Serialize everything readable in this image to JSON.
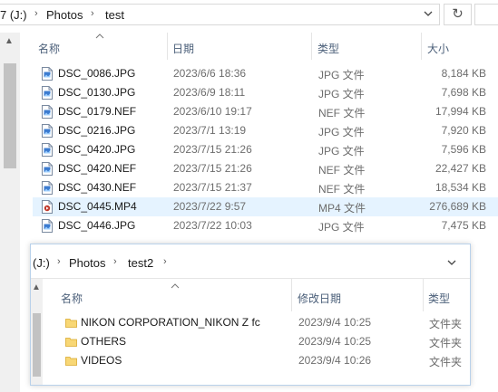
{
  "win1": {
    "address": {
      "crumbs": [
        "7 (J:)",
        "Photos",
        "test"
      ],
      "separator": "›",
      "dropdown_icon": "chevron-down-icon",
      "refresh_icon": "refresh-icon",
      "refresh_glyph": "↻"
    },
    "columns": {
      "name": "名称",
      "date": "日期",
      "type": "类型",
      "size": "大小"
    },
    "files": [
      {
        "name": "DSC_0086.JPG",
        "date": "2023/6/6 18:36",
        "type": "JPG 文件",
        "size": "8,184 KB",
        "icon": "image-file-icon"
      },
      {
        "name": "DSC_0130.JPG",
        "date": "2023/6/9 18:11",
        "type": "JPG 文件",
        "size": "7,698 KB",
        "icon": "image-file-icon"
      },
      {
        "name": "DSC_0179.NEF",
        "date": "2023/6/10 19:17",
        "type": "NEF 文件",
        "size": "17,994 KB",
        "icon": "image-file-icon"
      },
      {
        "name": "DSC_0216.JPG",
        "date": "2023/7/1 13:19",
        "type": "JPG 文件",
        "size": "7,920 KB",
        "icon": "image-file-icon"
      },
      {
        "name": "DSC_0420.JPG",
        "date": "2023/7/15 21:26",
        "type": "JPG 文件",
        "size": "7,596 KB",
        "icon": "image-file-icon"
      },
      {
        "name": "DSC_0420.NEF",
        "date": "2023/7/15 21:26",
        "type": "NEF 文件",
        "size": "22,427 KB",
        "icon": "image-file-icon"
      },
      {
        "name": "DSC_0430.NEF",
        "date": "2023/7/15 21:37",
        "type": "NEF 文件",
        "size": "18,534 KB",
        "icon": "image-file-icon"
      },
      {
        "name": "DSC_0445.MP4",
        "date": "2023/7/22 9:57",
        "type": "MP4 文件",
        "size": "276,689 KB",
        "icon": "video-file-icon"
      },
      {
        "name": "DSC_0446.JPG",
        "date": "2023/7/22 10:03",
        "type": "JPG 文件",
        "size": "7,475 KB",
        "icon": "image-file-icon"
      }
    ]
  },
  "win2": {
    "address": {
      "crumbs": [
        "(J:)",
        "Photos",
        "test2"
      ],
      "separator": "›",
      "dropdown_icon": "chevron-down-icon"
    },
    "columns": {
      "name": "名称",
      "date": "修改日期",
      "type": "类型"
    },
    "folders": [
      {
        "name": "NIKON CORPORATION_NIKON Z fc",
        "date": "2023/9/4 10:25",
        "type": "文件夹",
        "icon": "folder-icon"
      },
      {
        "name": "OTHERS",
        "date": "2023/9/4 10:25",
        "type": "文件夹",
        "icon": "folder-icon"
      },
      {
        "name": "VIDEOS",
        "date": "2023/9/4 10:26",
        "type": "文件夹",
        "icon": "folder-icon"
      }
    ]
  },
  "colors": {
    "selection": "#cce8ff",
    "hover": "#e5f3ff",
    "header_text": "#4c607a",
    "folder": "#f8d775",
    "window_border": "#b9d1ea"
  }
}
